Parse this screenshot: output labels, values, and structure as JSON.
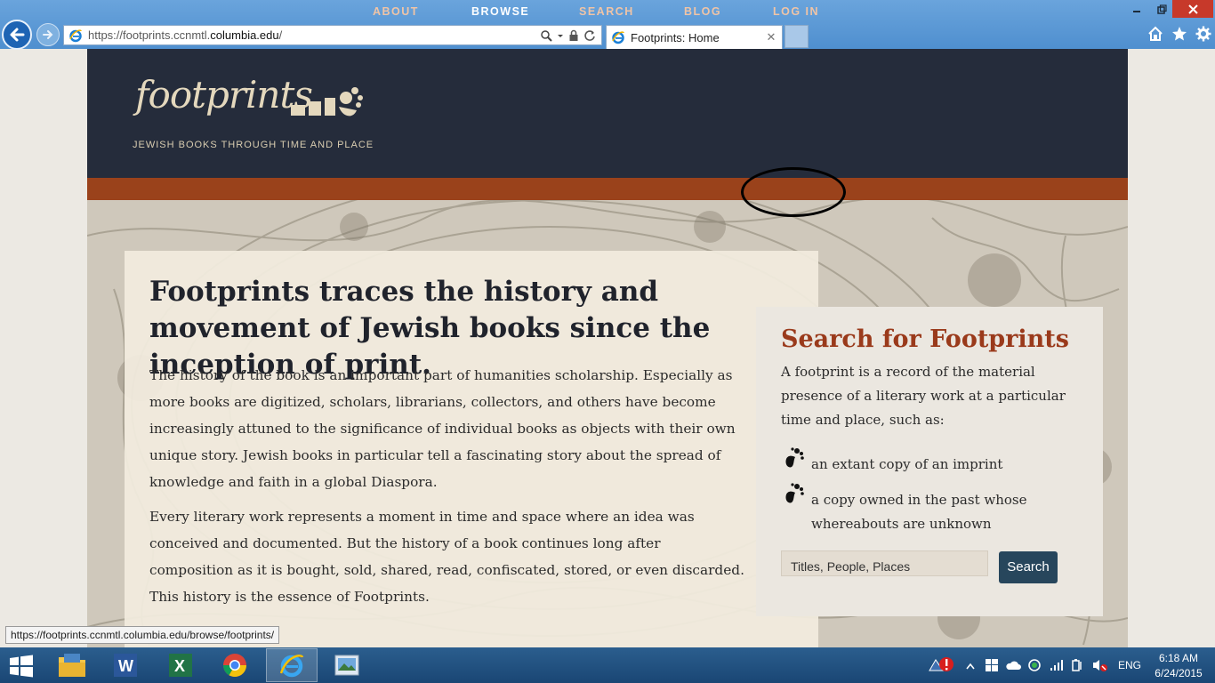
{
  "browser": {
    "url_prefix": "https://footprints.ccnmtl.",
    "url_domain": "columbia.edu",
    "url_suffix": "/",
    "tab_title": "Footprints: Home",
    "tab_close": "✕"
  },
  "site": {
    "logo_word": "footprints",
    "tagline": "JEWISH BOOKS THROUGH TIME AND PLACE",
    "nav": {
      "about": "ABOUT",
      "browse": "BROWSE",
      "search": "SEARCH",
      "blog": "BLOG",
      "login": "LOG IN"
    }
  },
  "intro": {
    "title": "Footprints traces the history and movement of Jewish books since the inception of print.",
    "p1": "The history of the book is an important part of humanities scholarship. Especially as more books are digitized, scholars, librarians, collectors, and others have become increasingly attuned to the significance of individual books as objects with their own unique story. Jewish books in particular tell a fascinating story about the spread of knowledge and faith in a global Diaspora.",
    "p2": "Every literary work represents a moment in time and space where an idea was conceived and documented. But the history of a book continues long after composition as it is bought, sold, shared, read, confiscated, stored, or even discarded. This history is the essence of Footprints."
  },
  "search_panel": {
    "title": "Search for Footprints",
    "description": "A footprint is a record of the material presence of a literary work at a particular time and place, such as:",
    "item1": "an extant copy of an imprint",
    "item2": "a copy owned in the past whose whereabouts are unknown",
    "input_placeholder": "Titles, People, Places",
    "button": "Search"
  },
  "status_url": "https://footprints.ccnmtl.columbia.edu/browse/footprints/",
  "taskbar": {
    "language": "ENG",
    "time": "6:18 AM",
    "date": "6/24/2015"
  },
  "colors": {
    "header_bg": "#252c3b",
    "nav_bg": "#9a421b",
    "accent_title": "#9a3a1b",
    "button_bg": "#27465c"
  }
}
